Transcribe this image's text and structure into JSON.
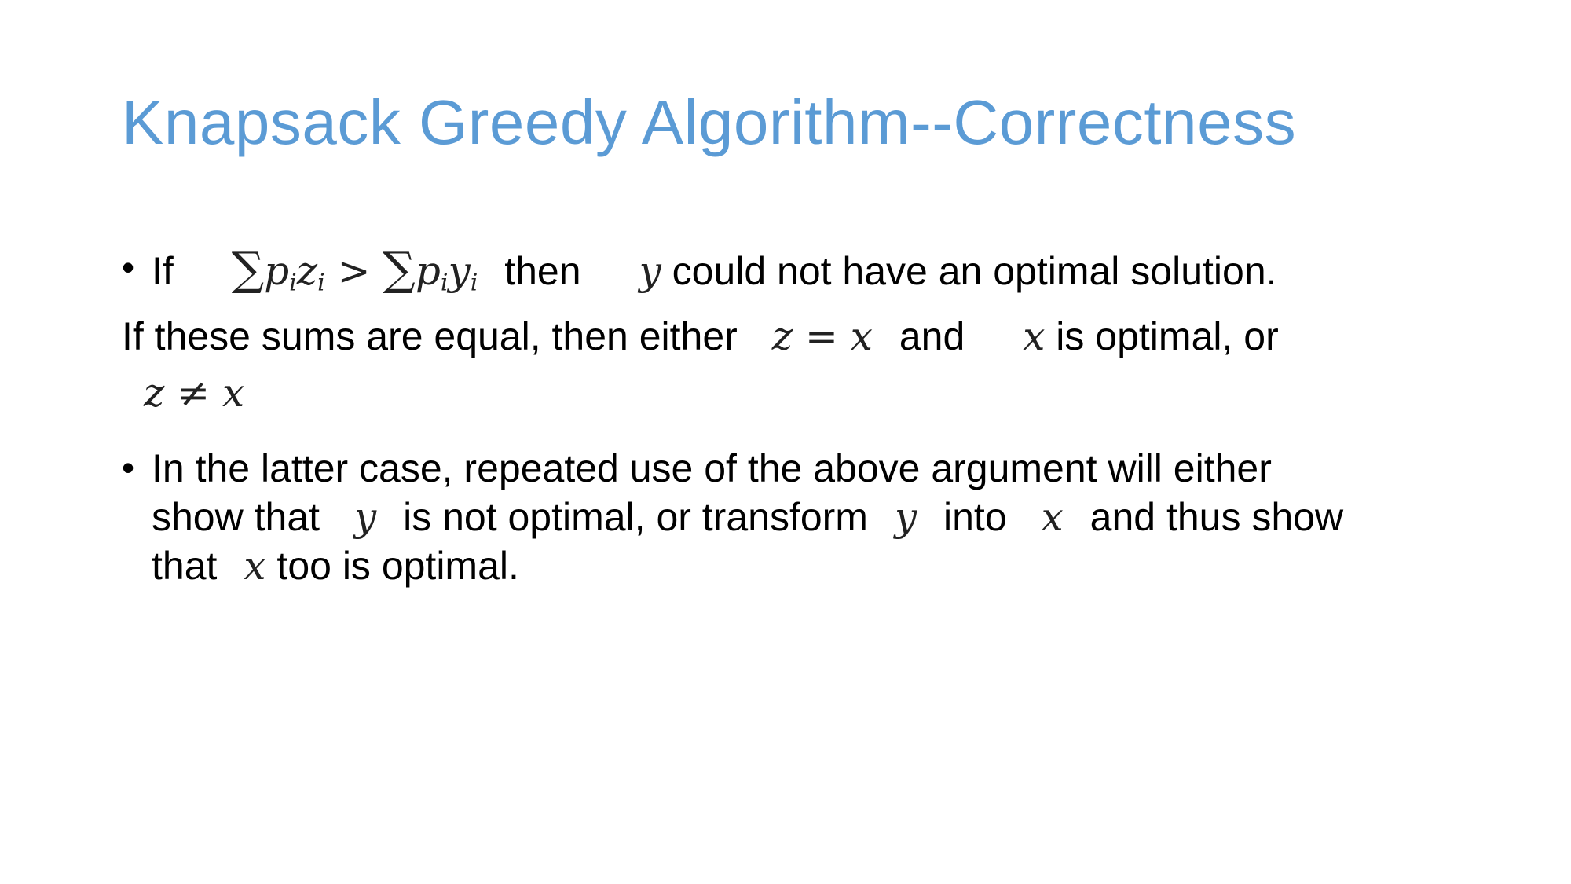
{
  "slide": {
    "title": "Knapsack Greedy Algorithm--Correctness",
    "bullet_glyph": "•",
    "line1": {
      "if": "If",
      "sum1_symbol": "∑",
      "sum1_p": "p",
      "sum1_i": "i",
      "sum1_z": "z",
      "sum1_i2": "i",
      "gt": ">",
      "sum2_symbol": "∑",
      "sum2_p": "p",
      "sum2_i": "i",
      "sum2_y": "y",
      "sum2_i2": "i",
      "then": "then",
      "var_y": "y",
      "rest": "could not have an optimal solution."
    },
    "line2": {
      "text_a": "If these sums are equal, then either",
      "eq_expr": "z = x",
      "and": "and",
      "var_x": "x",
      "text_b": "is optimal, or"
    },
    "line3": {
      "neq_expr": "z ≠ x"
    },
    "para2": {
      "l1": "In the latter case, repeated use of the above argument will either",
      "l2_a": "show that",
      "l2_y": "y",
      "l2_b": "is not optimal, or transform",
      "l2_y2": "y",
      "l2_c": "into",
      "l2_x": "x",
      "l2_d": "and thus show",
      "l3_a": "that",
      "l3_x": "x",
      "l3_b": "too is optimal."
    }
  }
}
